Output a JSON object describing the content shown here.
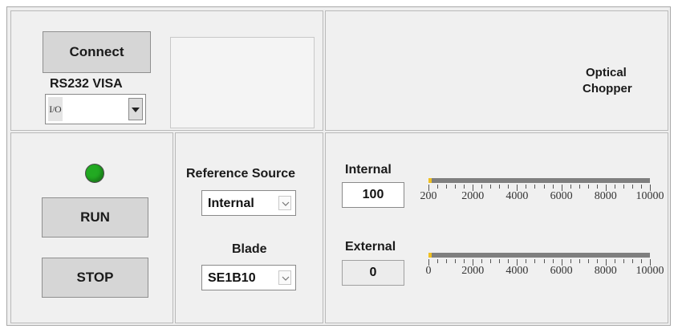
{
  "connection": {
    "connect_label": "Connect",
    "visa_label": "RS232 VISA",
    "visa_value": "",
    "visa_icon": "io-icon"
  },
  "title": {
    "line1": "Optical",
    "line2": "Chopper"
  },
  "run_panel": {
    "led_state": "on",
    "led_color": "#22aa22",
    "run_label": "RUN",
    "stop_label": "STOP"
  },
  "reference": {
    "source_label": "Reference Source",
    "source_value": "Internal",
    "blade_label": "Blade",
    "blade_value": "SE1B10"
  },
  "internal": {
    "label": "Internal",
    "value": "100",
    "slider_value": 100,
    "scale_min": 100,
    "scale_max": 10000,
    "ticks": [
      "200",
      "2000",
      "4000",
      "6000",
      "8000",
      "10000"
    ]
  },
  "external": {
    "label": "External",
    "value": "0",
    "slider_value": 0,
    "scale_min": 0,
    "scale_max": 10000,
    "ticks": [
      "0",
      "2000",
      "4000",
      "6000",
      "8000",
      "10000"
    ]
  },
  "colors": {
    "thumb": "#f0c020",
    "track": "#7f7f7f",
    "panel": "#efefef"
  }
}
